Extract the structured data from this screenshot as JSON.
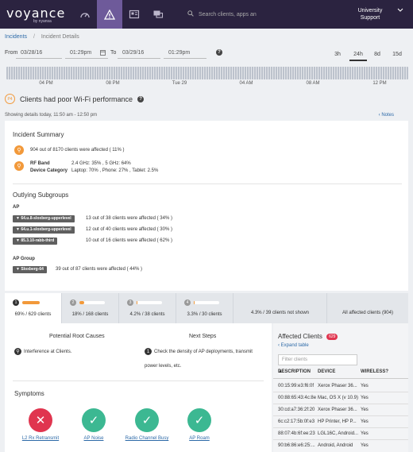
{
  "nav": {
    "logo": "voyance",
    "logo_sub": "by nyansa",
    "search_placeholder": "Search clients, apps an",
    "org_line1": "University",
    "org_line2": "Support"
  },
  "breadcrumb": {
    "root": "Incidents",
    "current": "Incident Details"
  },
  "range": {
    "from_label": "From",
    "from_date": "03/28/16",
    "from_time": "01:29pm",
    "to_label": "To",
    "to_date": "03/29/16",
    "to_time": "01:29pm",
    "buttons": [
      "3h",
      "24h",
      "8d",
      "15d"
    ],
    "selected": "24h"
  },
  "timeline_ticks": [
    "04 PM",
    "08 PM",
    "Tue 29",
    "04 AM",
    "08 AM",
    "12 PM"
  ],
  "incident": {
    "badge": "P4",
    "title": "Clients had poor Wi-Fi performance",
    "showing": "Showing details today, 11:50 am - 12:50 pm",
    "notes": "Notes"
  },
  "summary": {
    "heading": "Incident Summary",
    "affected_text": "904 out of 8170 clients were affected ( 11% )",
    "rf_label": "RF Band",
    "rf_value": "2.4 GHz: 35% , 5 GHz: 64%",
    "dev_label": "Device Category",
    "dev_value": "Laptop: 70% , Phone: 27% , Tablet: 2.5%"
  },
  "subgroups": {
    "heading": "Outlying Subgroups",
    "ap_label": "AP",
    "ap_items": [
      {
        "tag": "64.u.8-sloxberg-upperlevel",
        "text": "13 out of 38 clients were affected ( 34% )"
      },
      {
        "tag": "64.u.1-sloxberg-upperlevel",
        "text": "12 out of 40 clients were affected ( 30% )"
      },
      {
        "tag": "85.3.10-rabb-third",
        "text": "10 out of 16 clients were affected ( 62% )"
      }
    ],
    "group_label": "AP Group",
    "group_items": [
      {
        "tag": "Sloxberg-64",
        "text": "39 out of 87 clients were affected ( 44% )"
      }
    ]
  },
  "tabs": [
    {
      "num": "1",
      "label": "69% / 629 clients",
      "fill": 0.69
    },
    {
      "num": "2",
      "label": "18% / 168 clients",
      "fill": 0.18
    },
    {
      "num": "3",
      "label": "4.2% / 38 clients",
      "fill": 0.042
    },
    {
      "num": "4",
      "label": "3.3% / 30 clients",
      "fill": 0.033
    },
    {
      "label": "4.3% / 39 clients not shown"
    },
    {
      "label": "All affected clients  (904)"
    }
  ],
  "causes": {
    "heading": "Potential Root Causes",
    "item": "Interference at Clients."
  },
  "steps": {
    "heading": "Next Steps",
    "num": "1",
    "line1": "Check the density of AP deployments, transmit",
    "line2": "power levels, etc."
  },
  "symptoms": {
    "heading": "Symptoms",
    "items": [
      {
        "label": "L2 Rx Retransmit",
        "status": "bad"
      },
      {
        "label": "AP Noise",
        "status": "good"
      },
      {
        "label": "Radio Channel Busy",
        "status": "good"
      },
      {
        "label": "AP Roam",
        "status": "good"
      }
    ]
  },
  "affected": {
    "heading": "Affected Clients",
    "count": "629",
    "expand": "Expand table",
    "filter_placeholder": "Filter clients",
    "columns": [
      "DESCRIPTION",
      "DEVICE",
      "WIRELESS?"
    ],
    "rows": [
      [
        "00:15:99:e3:f6:0f",
        "Xerox Phaser 36...",
        "Yes"
      ],
      [
        "00:88:65:43:4c:8e",
        "Mac, OS X (v 10.9)",
        "Yes"
      ],
      [
        "30:cd:a7:36:2f:20",
        "Xerox Phaser 36...",
        "Yes"
      ],
      [
        "6c:c2:17:5b:0f:e3",
        "HP Printer, HP P...",
        "Yes"
      ],
      [
        "88:07:4b:6f:ee:23",
        "LGL16C, Android...",
        "Yes"
      ],
      [
        "90:b6:86:e6:25:...",
        "Android, Android",
        "Yes"
      ]
    ]
  }
}
